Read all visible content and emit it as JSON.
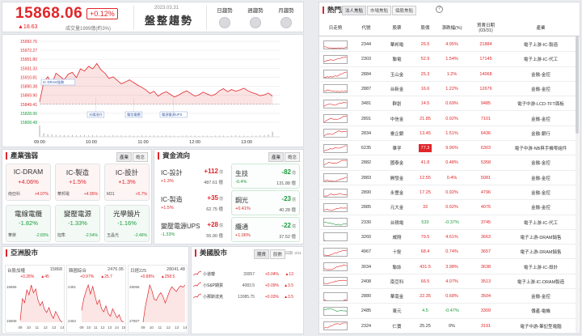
{
  "header": {
    "index_value": "15868.06",
    "index_pct": "+0.12%",
    "index_change": "▲18.63",
    "volume": "成交量1999億(約3%)",
    "date": "2023.03.31",
    "trend": "盤整趨勢",
    "trend_checks": [
      "日趨勢",
      "週趨勢",
      "月趨勢"
    ]
  },
  "main_chart": {
    "y_ticks": [
      "15992.76",
      "15972.27",
      "15951.80",
      "15931.33",
      "15910.81",
      "15890.38",
      "15869.90",
      "15849.41",
      "15828.96",
      "15808.48"
    ],
    "x_ticks": [
      "09:00",
      "10:00",
      "11:00",
      "12:00",
      "13:00"
    ],
    "ylim": [
      15808.48,
      15992.76
    ],
    "prev_close": 15849.41,
    "prices": [
      15855,
      15900,
      15912,
      15895,
      15920,
      15913,
      15905,
      15918,
      15922,
      15910,
      15930,
      15925,
      15936,
      15930,
      15942,
      15928,
      15920,
      15908,
      15912,
      15904,
      15896,
      15900,
      15905,
      15899,
      15893,
      15888,
      15882,
      15874,
      15879,
      15868,
      15874,
      15878,
      15872,
      15866,
      15870,
      15876,
      15880,
      15874,
      15868,
      15871,
      15877,
      15873,
      15869,
      15872,
      15880,
      15885,
      15878,
      15883,
      15879,
      15882,
      15886,
      15880,
      15876,
      15873,
      15869,
      15871,
      15875,
      15868
    ],
    "volumes": [
      40,
      12,
      9,
      8,
      7,
      6,
      6,
      5,
      6,
      5,
      5,
      6,
      5,
      6,
      5,
      4,
      5,
      4,
      6,
      5,
      5,
      4,
      5,
      4,
      4,
      5,
      4,
      4,
      5,
      4,
      4,
      5,
      4,
      4,
      3,
      4,
      5,
      4,
      4,
      3,
      4,
      4,
      3,
      4,
      4,
      4,
      3,
      4,
      5,
      4,
      4,
      3,
      4,
      4,
      5,
      6,
      8,
      18
    ],
    "annotations": [
      "IC-DRAM強勢",
      "光碟漲升",
      "電信電纜",
      "電源電源UPS"
    ]
  },
  "sector": {
    "title": "產業強弱",
    "tabs": [
      "產業",
      "概念"
    ],
    "cards": [
      {
        "name": "IC-DRAM",
        "pct": "+4.06%",
        "stock": "南亞科",
        "stock_pct": "+4.07%",
        "dir": "up"
      },
      {
        "name": "IC-製造",
        "pct": "+1.5%",
        "stock": "華邦電",
        "stock_pct": "+4.95%",
        "dir": "up"
      },
      {
        "name": "IC-設計",
        "pct": "+1.3%",
        "stock": "M31",
        "stock_pct": "+5.7%",
        "dir": "up"
      },
      {
        "name": "電線電纜",
        "pct": "-1.82%",
        "stock": "華榮",
        "stock_pct": "-2.83%",
        "dir": "down"
      },
      {
        "name": "變壓電源",
        "pct": "-1.33%",
        "stock": "旭隼",
        "stock_pct": "-2.54%",
        "dir": "down"
      },
      {
        "name": "光學鏡片",
        "pct": "-1.16%",
        "stock": "玉晶光",
        "stock_pct": "-2.46%",
        "dir": "down"
      }
    ]
  },
  "flow": {
    "title": "資金流向",
    "tabs": [
      "產業",
      "概念"
    ],
    "left": [
      {
        "name": "IC-設計",
        "value": "+112",
        "unit": "億",
        "pct": "+1.3%",
        "vol": "487.61 億"
      },
      {
        "name": "IC-製造",
        "value": "+35",
        "unit": "億",
        "pct": "+1.5%",
        "vol": "62.75 億"
      },
      {
        "name": "變壓電源UPS",
        "value": "+28",
        "unit": "億",
        "pct": "-1.33%",
        "vol": "55.90 億"
      }
    ],
    "right": [
      {
        "name": "生技",
        "value": "-82",
        "unit": "億",
        "pct": "-0.4%",
        "vol": "131.88 億"
      },
      {
        "name": "鋼光",
        "value": "-23",
        "unit": "億",
        "pct": "+0.41%",
        "vol": "40.28 億"
      },
      {
        "name": "纜通",
        "value": "-22",
        "unit": "億",
        "pct": "+1.06%",
        "vol": "37.52 億"
      }
    ]
  },
  "asia": {
    "title": "亞洲股市",
    "markets": [
      {
        "name": "台股加權",
        "value": "15868",
        "pct": "+0.28%",
        "chg": "▲45",
        "y_top": "15865",
        "y_bot": "15808",
        "x_ticks": [
          "09",
          "10",
          "11",
          "12",
          "13",
          "14"
        ],
        "prices": [
          15830,
          15852,
          15848,
          15861,
          15856,
          15866,
          15858,
          15862,
          15851,
          15845,
          15849,
          15841,
          15838,
          15843,
          15836,
          15832,
          15839,
          15835,
          15830,
          15828
        ]
      },
      {
        "name": "韓國綜合",
        "value": "2476.95",
        "pct": "+0.97%",
        "chg": "▲25.7",
        "y_top": "2481",
        "y_bot": "2452",
        "x_ticks": [
          "09",
          "10",
          "11",
          "12",
          "13",
          "14",
          "15"
        ],
        "prices": [
          2462,
          2470,
          2475,
          2479,
          2473,
          2478,
          2472,
          2466,
          2469,
          2463,
          2461,
          2465,
          2460,
          2458,
          2463,
          2460,
          2457,
          2459,
          2455,
          2454
        ]
      },
      {
        "name": "日經225",
        "value": "28041.48",
        "pct": "+0.89%",
        "chg": "▲258.5",
        "y_top": "28066",
        "y_bot": "27807",
        "x_ticks": [
          "09",
          "10",
          "11",
          "12",
          "13",
          "14"
        ],
        "prices": [
          27890,
          27960,
          28010,
          28060,
          28035,
          27995,
          27990,
          28012,
          28025,
          28008,
          27978,
          28005,
          28033,
          28052,
          28041,
          28030,
          28046,
          28056,
          28050,
          28060
        ]
      }
    ]
  },
  "us": {
    "title": "美國股市",
    "tabs": [
      "期貨",
      "股數"
    ],
    "date": "日期: 3/31",
    "rows": [
      {
        "name": "小道瓊",
        "value": "33057",
        "pct": "+0.04%",
        "chg": "▲13"
      },
      {
        "name": "小S&P期貨",
        "value": "4083.5",
        "pct": "+0.09%",
        "chg": "▲3.5"
      },
      {
        "name": "小那斯達克",
        "value": "13085.75",
        "pct": "+0.03%",
        "chg": "▲3.5"
      }
    ]
  },
  "hot": {
    "title": "熱門股",
    "tabs": [
      "法人焦點",
      "市場焦點",
      "個股焦點"
    ],
    "headers": [
      "日走勢",
      "代號",
      "股票",
      "股價",
      "漲跌幅(%)",
      "買賣日期\n(03/31)",
      "產業"
    ],
    "rows": [
      {
        "code": "2344",
        "name": "華邦電",
        "price": "26.5",
        "pct": "4.95%",
        "vol": "21884",
        "ind": "電子上游-IC-製造",
        "dir": "up"
      },
      {
        "code": "2303",
        "name": "聯電",
        "price": "52.9",
        "pct": "1.54%",
        "vol": "17145",
        "ind": "電子上游-IC-代工",
        "dir": "up"
      },
      {
        "code": "2884",
        "name": "玉山金",
        "price": "25.3",
        "pct": "1.2%",
        "vol": "14068",
        "ind": "金融-金控",
        "dir": "up"
      },
      {
        "code": "2887",
        "name": "台新金",
        "price": "16.6",
        "pct": "1.22%",
        "vol": "12676",
        "ind": "金融-金控",
        "dir": "up"
      },
      {
        "code": "3481",
        "name": "群創",
        "price": "14.5",
        "pct": "0.69%",
        "vol": "9485",
        "ind": "電子中游-LCD-TFT面板",
        "dir": "up"
      },
      {
        "code": "2891",
        "name": "中信金",
        "price": "21.85",
        "pct": "0.92%",
        "vol": "7101",
        "ind": "金融-金控",
        "dir": "up"
      },
      {
        "code": "2834",
        "name": "臺企銀",
        "price": "13.45",
        "pct": "1.51%",
        "vol": "6436",
        "ind": "金融-銀行",
        "dir": "up"
      },
      {
        "code": "6235",
        "name": "華孚",
        "price": "77.3",
        "pct": "9.96%",
        "vol": "6303",
        "ind": "電子中游-NB與手機零組件",
        "dir": "up",
        "limit": true
      },
      {
        "code": "2882",
        "name": "國泰金",
        "price": "41.8",
        "pct": "0.48%",
        "vol": "5358",
        "ind": "金融-金控",
        "dir": "up"
      },
      {
        "code": "2883",
        "name": "開發金",
        "price": "12.55",
        "pct": "0.4%",
        "vol": "5081",
        "ind": "金融-金控",
        "dir": "up"
      },
      {
        "code": "2890",
        "name": "永豐金",
        "price": "17.25",
        "pct": "0.92%",
        "vol": "4796",
        "ind": "金融-金控",
        "dir": "up"
      },
      {
        "code": "2885",
        "name": "元大金",
        "price": "33",
        "pct": "0.92%",
        "vol": "4076",
        "ind": "金融-金控",
        "dir": "up"
      },
      {
        "code": "2330",
        "name": "台積電",
        "price": "533",
        "pct": "-0.37%",
        "vol": "3745",
        "ind": "電子上游-IC-代工",
        "dir": "down"
      },
      {
        "code": "3260",
        "name": "威剛",
        "price": "79.5",
        "pct": "4.61%",
        "vol": "3663",
        "ind": "電子上游-DRAM銷售",
        "dir": "up"
      },
      {
        "code": "4967",
        "name": "十銓",
        "price": "68.4",
        "pct": "0.74%",
        "vol": "3657",
        "ind": "電子上游-DRAM銷售",
        "dir": "up"
      },
      {
        "code": "3034",
        "name": "聯詠",
        "price": "431.5",
        "pct": "3.98%",
        "vol": "3638",
        "ind": "電子上游-IC-設計",
        "dir": "up"
      },
      {
        "code": "2408",
        "name": "南亞科",
        "price": "66.5",
        "pct": "4.07%",
        "vol": "3513",
        "ind": "電子上游-IC-DRAM製造",
        "dir": "up"
      },
      {
        "code": "2880",
        "name": "華南金",
        "price": "22.35",
        "pct": "0.68%",
        "vol": "3504",
        "ind": "金融-金控",
        "dir": "up"
      },
      {
        "code": "2485",
        "name": "東元",
        "price": "4.5",
        "pct": "-0.47%",
        "vol": "3309",
        "ind": "傳產-電機",
        "dir": "down"
      },
      {
        "code": "2324",
        "name": "仁寶",
        "price": "25.25",
        "pct": "0%",
        "vol": "3191",
        "ind": "電子中游-筆記型電腦",
        "dir": "flat"
      }
    ]
  },
  "colors": {
    "up": "#e0262a",
    "down": "#1a9b3c",
    "accent": "#e0262a"
  }
}
